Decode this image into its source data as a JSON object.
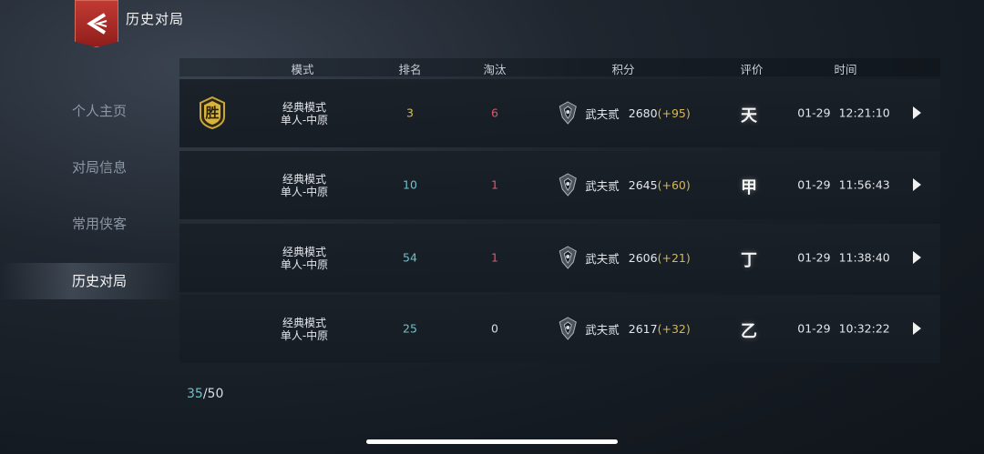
{
  "header": {
    "title": "历史对局"
  },
  "sidebar": {
    "items": [
      {
        "label": "个人主页"
      },
      {
        "label": "对局信息"
      },
      {
        "label": "常用侠客"
      },
      {
        "label": "历史对局",
        "active": true
      }
    ]
  },
  "table": {
    "headers": {
      "mode": "模式",
      "rank": "排名",
      "kills": "淘汰",
      "score": "积分",
      "grade": "评价",
      "time": "时间"
    },
    "rows": [
      {
        "result": "胜",
        "mode_line1": "经典模式",
        "mode_line2": "单人-中原",
        "rank": "3",
        "rank_color": "#d8c04a",
        "kills": "6",
        "kills_color": "#e0566e",
        "rank_title": "武夫贰",
        "score": "2680",
        "delta": "(+95)",
        "grade": "天",
        "date": "01-29",
        "clock": "12:21:10"
      },
      {
        "result": "",
        "mode_line1": "经典模式",
        "mode_line2": "单人-中原",
        "rank": "10",
        "rank_color": "#6fc0c8",
        "kills": "1",
        "kills_color": "#e0566e",
        "rank_title": "武夫贰",
        "score": "2645",
        "delta": "(+60)",
        "grade": "甲",
        "date": "01-29",
        "clock": "11:56:43"
      },
      {
        "result": "",
        "mode_line1": "经典模式",
        "mode_line2": "单人-中原",
        "rank": "54",
        "rank_color": "#6fc0c8",
        "kills": "1",
        "kills_color": "#e0566e",
        "rank_title": "武夫贰",
        "score": "2606",
        "delta": "(+21)",
        "grade": "丁",
        "date": "01-29",
        "clock": "11:38:40"
      },
      {
        "result": "",
        "mode_line1": "经典模式",
        "mode_line2": "单人-中原",
        "rank": "25",
        "rank_color": "#6fc0c8",
        "kills": "0",
        "kills_color": "#d8dde3",
        "rank_title": "武夫贰",
        "score": "2617",
        "delta": "(+32)",
        "grade": "乙",
        "date": "01-29",
        "clock": "10:32:22"
      }
    ]
  },
  "pager": {
    "current": "35",
    "total": "50"
  },
  "colors": {
    "accent_red": "#b12c27",
    "teal": "#6fc0c8",
    "gold": "#d6b755",
    "pink": "#e0566e"
  },
  "icons": {
    "back": "back-chevron-icon",
    "win": "win-badge-icon",
    "rank": "rank-emblem-icon",
    "detail": "play-arrow-icon"
  }
}
